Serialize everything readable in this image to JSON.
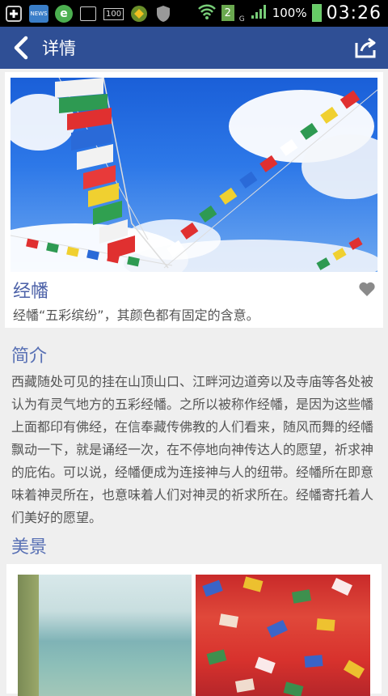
{
  "status_bar": {
    "news_icon_label": "NEWS",
    "app_e_icon_label": "e",
    "count_badge": "100",
    "sim_slot": "2",
    "network_type": "G",
    "battery_percent": "100%",
    "time": "03:26"
  },
  "action_bar": {
    "title": "详情"
  },
  "card": {
    "title": "经幡",
    "description": "经幡“五彩缤纷”，其颜色都有固定的含意。"
  },
  "intro": {
    "heading": "简介",
    "body": "西藏随处可见的挂在山顶山口、江畔河边道旁以及寺庙等各处被认为有灵气地方的五彩经幡。之所以被称作经幡，是因为这些幡上面都印有佛经，在信奉藏传佛教的人们看来，随风而舞的经幡飘动一下，就是诵经一次，在不停地向神传达人的愿望，祈求神的庇佑。可以说，经幡便成为连接神与人的纽带。经幡所在即意味着神灵所在，也意味着人们对神灵的祈求所在。经幡寄托着人们美好的愿望。"
  },
  "gallery": {
    "heading": "美景"
  },
  "colors": {
    "action_bar": "#2f4f95",
    "heading": "#5870b4",
    "card_title": "#4d62a8",
    "body_text": "#555555",
    "background": "#efefef"
  }
}
